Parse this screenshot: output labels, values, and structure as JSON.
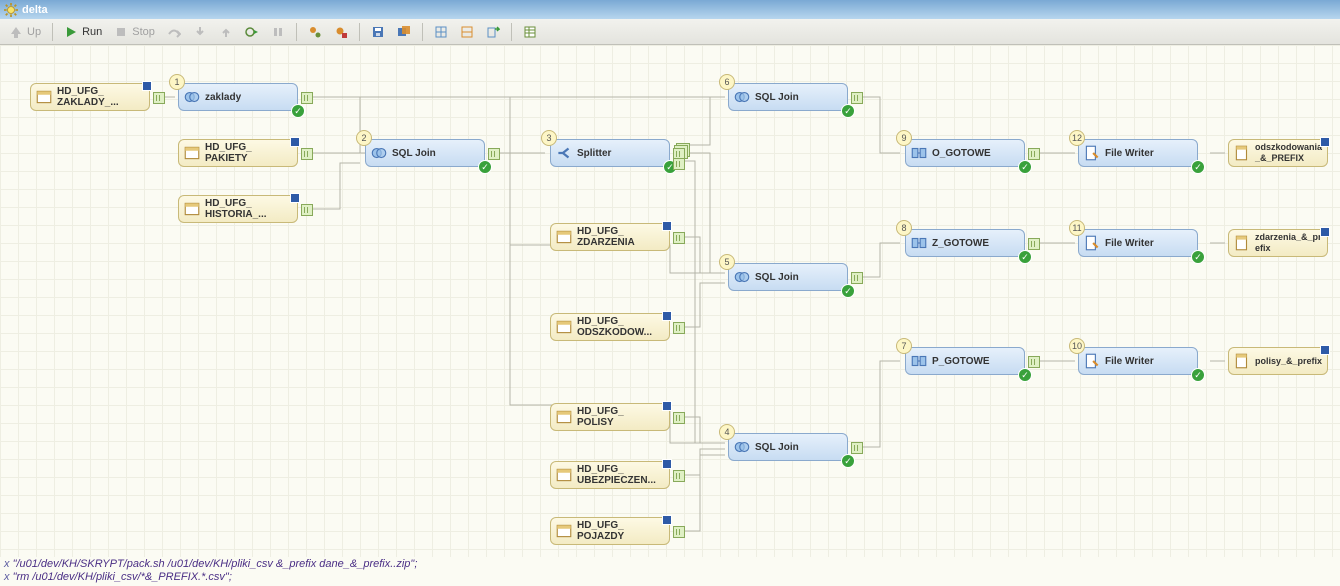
{
  "titlebar": {
    "title": "delta"
  },
  "toolbar": {
    "up": "Up",
    "run": "Run",
    "stop": "Stop"
  },
  "nodes": {
    "zaklady_src": {
      "label": "HD_UFG_\nZAKLADY_..."
    },
    "pakiety": {
      "label": "HD_UFG_\nPAKIETY"
    },
    "historia": {
      "label": "HD_UFG_\nHISTORIA_..."
    },
    "zdarzenia": {
      "label": "HD_UFG_\nZDARZENIA"
    },
    "odszkodow": {
      "label": "HD_UFG_\nODSZKODOW..."
    },
    "polisy": {
      "label": "HD_UFG_\nPOLISY"
    },
    "ubezp": {
      "label": "HD_UFG_\nUBEZPIECZEN..."
    },
    "pojazdy": {
      "label": "HD_UFG_\nPOJAZDY"
    },
    "zaklady": {
      "num": "1",
      "label": "zaklady"
    },
    "sqljoin2": {
      "num": "2",
      "label": "SQL Join"
    },
    "splitter": {
      "num": "3",
      "label": "Splitter"
    },
    "sqljoin4": {
      "num": "4",
      "label": "SQL Join"
    },
    "sqljoin5": {
      "num": "5",
      "label": "SQL Join"
    },
    "sqljoin6": {
      "num": "6",
      "label": "SQL Join"
    },
    "p_gotowe": {
      "num": "7",
      "label": "P_GOTOWE"
    },
    "z_gotowe": {
      "num": "8",
      "label": "Z_GOTOWE"
    },
    "o_gotowe": {
      "num": "9",
      "label": "O_GOTOWE"
    },
    "fw10": {
      "num": "10",
      "label": "File Writer"
    },
    "fw11": {
      "num": "11",
      "label": "File Writer"
    },
    "fw12": {
      "num": "12",
      "label": "File Writer"
    },
    "out_odsz": {
      "label": "odszkodowania_&_PREFIX"
    },
    "out_zdar": {
      "label": "zdarzenia_&_prefix"
    },
    "out_pol": {
      "label": "polisy_&_prefix"
    }
  },
  "status": {
    "line1": "\"/u01/dev/KH/SKRYPT/pack.sh /u01/dev/KH/pliki_csv &_prefix dane_&_prefix..zip\";",
    "line2": "\"rm /u01/dev/KH/pliki_csv/*&_PREFIX.*.csv\";"
  }
}
